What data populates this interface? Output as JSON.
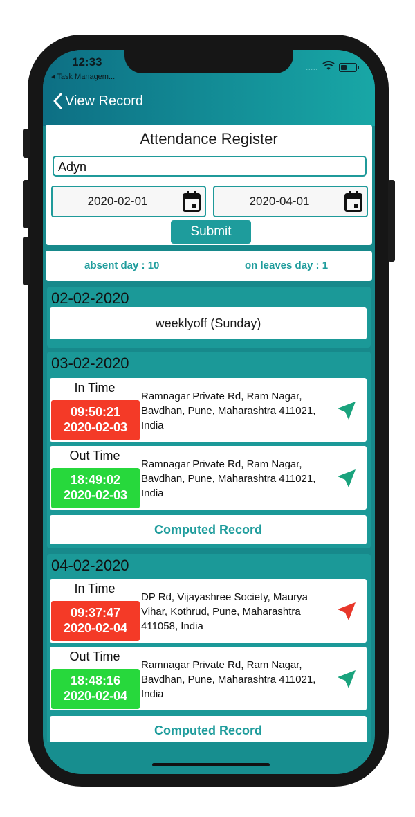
{
  "status": {
    "time": "12:33",
    "back_app": "◂ Task Managem...",
    "signal_dots": "....."
  },
  "nav": {
    "back_label": "View Record"
  },
  "register": {
    "title": "Attendance Register",
    "name_value": "Adyn",
    "from_date": "2020-02-01",
    "to_date": "2020-04-01",
    "submit_label": "Submit"
  },
  "summary": {
    "absent": "absent day : 10",
    "leaves": "on leaves day : 1"
  },
  "colors": {
    "teal": "#1b9998",
    "accent": "#1e9c9c",
    "in_badge": "#f43a27",
    "out_badge": "#27d83c",
    "icon_green": "#1aa37d",
    "icon_red": "#e8372a"
  },
  "days": [
    {
      "date": "02-02-2020",
      "note": "weeklyoff (Sunday)"
    },
    {
      "date": "03-02-2020",
      "in": {
        "label": "In Time",
        "time": "09:50:21",
        "day": "2020-02-03",
        "address": "Ramnagar Private Rd, Ram Nagar, Bavdhan, Pune, Maharashtra 411021, India",
        "icon": "navigation-arrow-icon"
      },
      "out": {
        "label": "Out Time",
        "time": "18:49:02",
        "day": "2020-02-03",
        "address": "Ramnagar Private Rd, Ram Nagar, Bavdhan, Pune, Maharashtra 411021, India",
        "icon": "navigation-arrow-icon"
      },
      "computed_label": "Computed Record"
    },
    {
      "date": "04-02-2020",
      "in": {
        "label": "In Time",
        "time": "09:37:47",
        "day": "2020-02-04",
        "address": "DP Rd, Vijayashree Society, Maurya Vihar, Kothrud, Pune, Maharashtra 411058, India",
        "icon": "navigation-arrow-icon"
      },
      "out": {
        "label": "Out Time",
        "time": "18:48:16",
        "day": "2020-02-04",
        "address": "Ramnagar Private Rd, Ram Nagar, Bavdhan, Pune, Maharashtra 411021, India",
        "icon": "navigation-arrow-icon"
      },
      "computed_label": "Computed Record"
    }
  ]
}
